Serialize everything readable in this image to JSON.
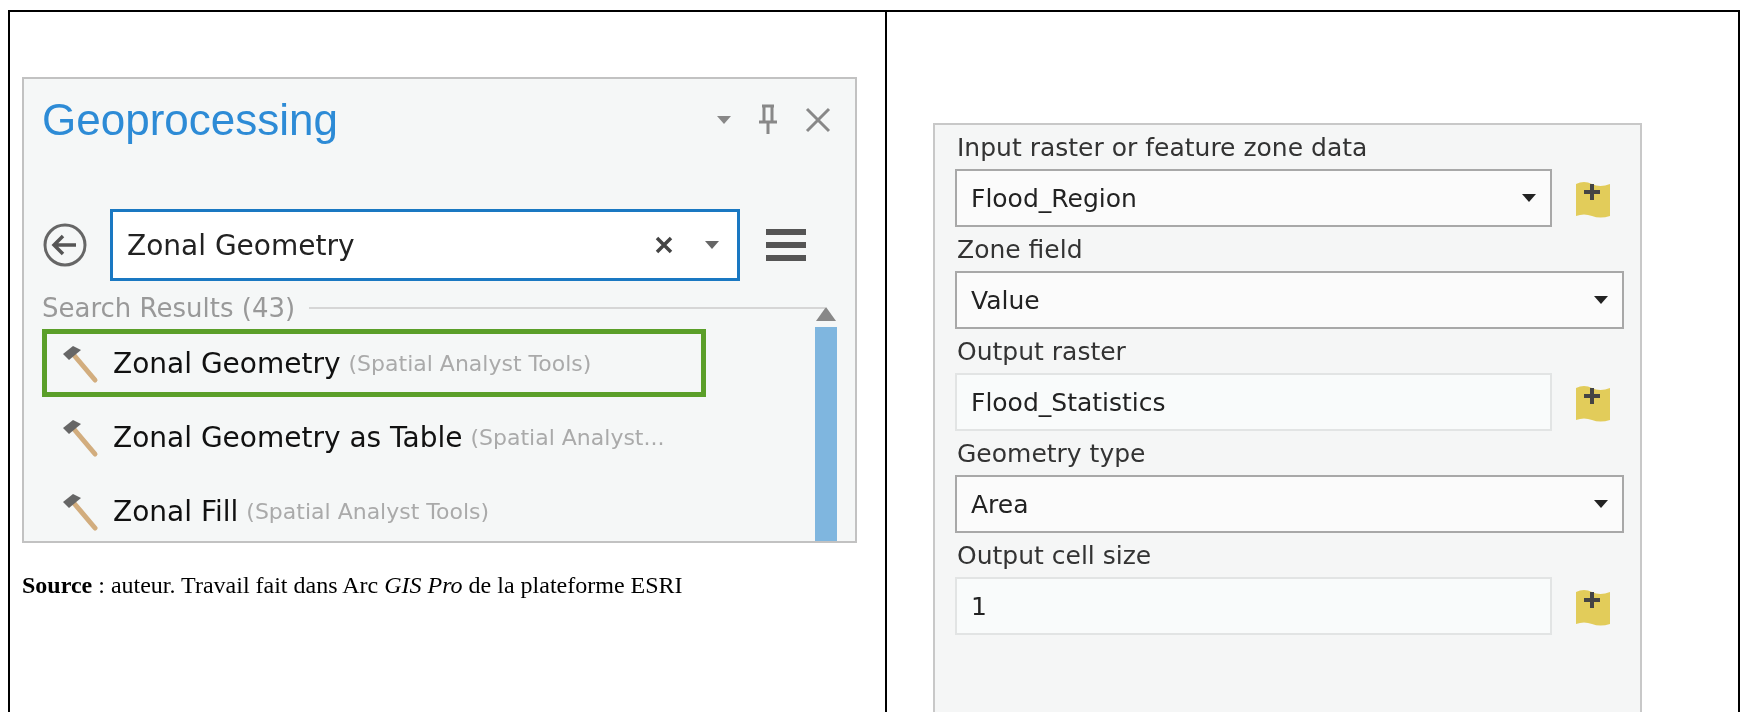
{
  "geoprocessing": {
    "title": "Geoprocessing",
    "search": {
      "value": "Zonal Geometry"
    },
    "results_header": "Search Results (43)",
    "results": [
      {
        "name": "Zonal Geometry",
        "toolbox": "(Spatial Analyst Tools)",
        "selected": true
      },
      {
        "name": "Zonal Geometry as Table",
        "toolbox": "(Spatial Analyst...",
        "selected": false
      },
      {
        "name": "Zonal Fill",
        "toolbox": "(Spatial Analyst Tools)",
        "selected": false
      }
    ]
  },
  "caption": "**Source** : auteur. Travail fait dans Arc *GIS Pro* de la plateforme ESRI",
  "parameters": [
    {
      "label": "Input raster or feature zone data",
      "kind": "dropdown",
      "value": "Flood_Region",
      "browse": true
    },
    {
      "label": "Zone field",
      "kind": "dropdown",
      "value": "Value",
      "browse": false
    },
    {
      "label": "Output raster",
      "kind": "text",
      "value": "Flood_Statistics",
      "browse": true
    },
    {
      "label": "Geometry type",
      "kind": "dropdown",
      "value": "Area",
      "browse": false
    },
    {
      "label": "Output cell size",
      "kind": "text",
      "value": "1",
      "browse": true
    }
  ]
}
